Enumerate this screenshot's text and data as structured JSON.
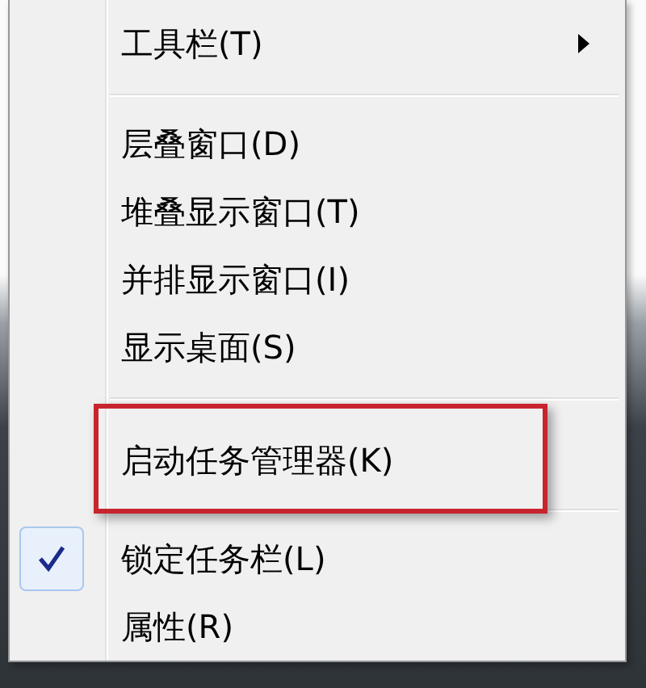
{
  "menu": {
    "items": [
      {
        "kind": "item",
        "label": "工具栏(T)",
        "submenu": true,
        "checked": false,
        "highlighted": false
      },
      {
        "kind": "separator"
      },
      {
        "kind": "item",
        "label": "层叠窗口(D)",
        "submenu": false,
        "checked": false,
        "highlighted": false
      },
      {
        "kind": "item",
        "label": "堆叠显示窗口(T)",
        "submenu": false,
        "checked": false,
        "highlighted": false
      },
      {
        "kind": "item",
        "label": "并排显示窗口(I)",
        "submenu": false,
        "checked": false,
        "highlighted": false
      },
      {
        "kind": "item",
        "label": "显示桌面(S)",
        "submenu": false,
        "checked": false,
        "highlighted": false
      },
      {
        "kind": "separator"
      },
      {
        "kind": "item",
        "label": "启动任务管理器(K)",
        "submenu": false,
        "checked": false,
        "highlighted": true
      },
      {
        "kind": "separator"
      },
      {
        "kind": "item",
        "label": "锁定任务栏(L)",
        "submenu": false,
        "checked": true,
        "highlighted": false
      },
      {
        "kind": "item",
        "label": "属性(R)",
        "submenu": false,
        "checked": false,
        "highlighted": false
      }
    ]
  }
}
